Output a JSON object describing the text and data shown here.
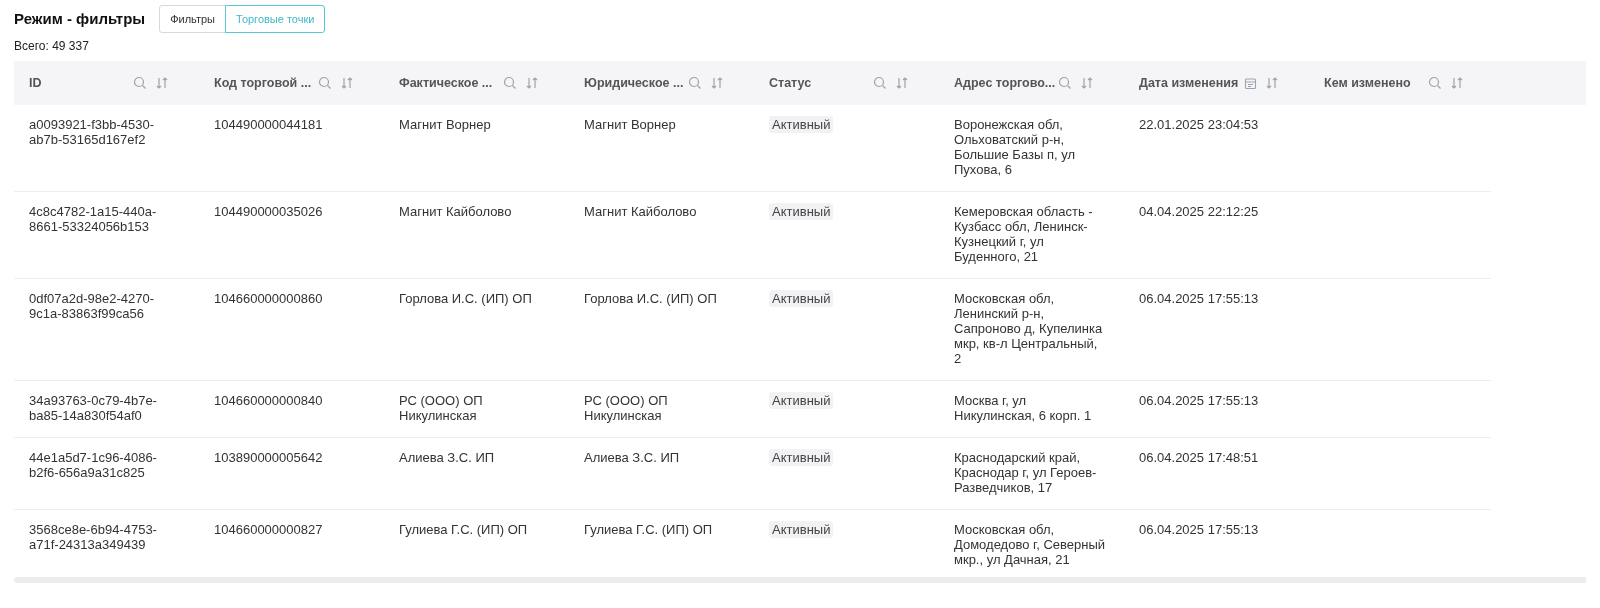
{
  "title": "Режим - фильтры",
  "tabs": [
    {
      "label": "Фильтры",
      "selected": false
    },
    {
      "label": "Торговые точки",
      "selected": true
    }
  ],
  "total": "Всего: 49 337",
  "table": {
    "columns": [
      {
        "label": "ID",
        "date_filter": false
      },
      {
        "label": "Код торговой ...",
        "date_filter": false
      },
      {
        "label": "Фактическое ...",
        "date_filter": false
      },
      {
        "label": "Юридическое ...",
        "date_filter": false
      },
      {
        "label": "Статус",
        "date_filter": false
      },
      {
        "label": "Адрес торгово...",
        "date_filter": false
      },
      {
        "label": "Дата изменения",
        "date_filter": true
      },
      {
        "label": "Кем изменено",
        "date_filter": false
      }
    ],
    "rows": [
      [
        "a0093921-f3bb-4530-ab7b-53165d167ef2",
        "104490000044181",
        "Магнит Ворнер",
        "Магнит Ворнер",
        "Активный",
        "Воронежская обл, Ольховатский р-н, Большие Базы п, ул Пухова, 6",
        "22.01.2025 23:04:53",
        ""
      ],
      [
        "4c8c4782-1a15-440a-8661-53324056b153",
        "104490000035026",
        "Магнит Кайболово",
        "Магнит Кайболово",
        "Активный",
        "Кемеровская область - Кузбасс обл, Ленинск-Кузнецкий г, ул Буденного, 21",
        "04.04.2025 22:12:25",
        ""
      ],
      [
        "0df07a2d-98e2-4270-9c1a-83863f99ca56",
        "104660000000860",
        "Горлова И.С. (ИП) ОП",
        "Горлова И.С. (ИП) ОП",
        "Активный",
        "Московская обл, Ленинский р-н, Сапроново д, Купелинка мкр, кв-л Центральный, 2",
        "06.04.2025 17:55:13",
        ""
      ],
      [
        "34a93763-0c79-4b7e-ba85-14a830f54af0",
        "104660000000840",
        "РС (ООО) ОП Никулинская",
        "РС (ООО) ОП Никулинская",
        "Активный",
        "Москва г, ул Никулинская, 6 корп. 1",
        "06.04.2025 17:55:13",
        ""
      ],
      [
        "44e1a5d7-1c96-4086-b2f6-656a9a31c825",
        "103890000005642",
        "Алиева З.С. ИП",
        "Алиева З.С. ИП",
        "Активный",
        "Краснодарский край, Краснодар г, ул Героев-Разведчиков, 17",
        "06.04.2025 17:48:51",
        ""
      ],
      [
        "3568ce8e-6b94-4753-a71f-24313a349439",
        "104660000000827",
        "Гулиева Г.С. (ИП) ОП",
        "Гулиева Г.С. (ИП) ОП",
        "Активный",
        "Московская обл, Домодедово г, Северный мкр., ул Дачная, 21",
        "06.04.2025 17:55:13",
        ""
      ]
    ]
  }
}
